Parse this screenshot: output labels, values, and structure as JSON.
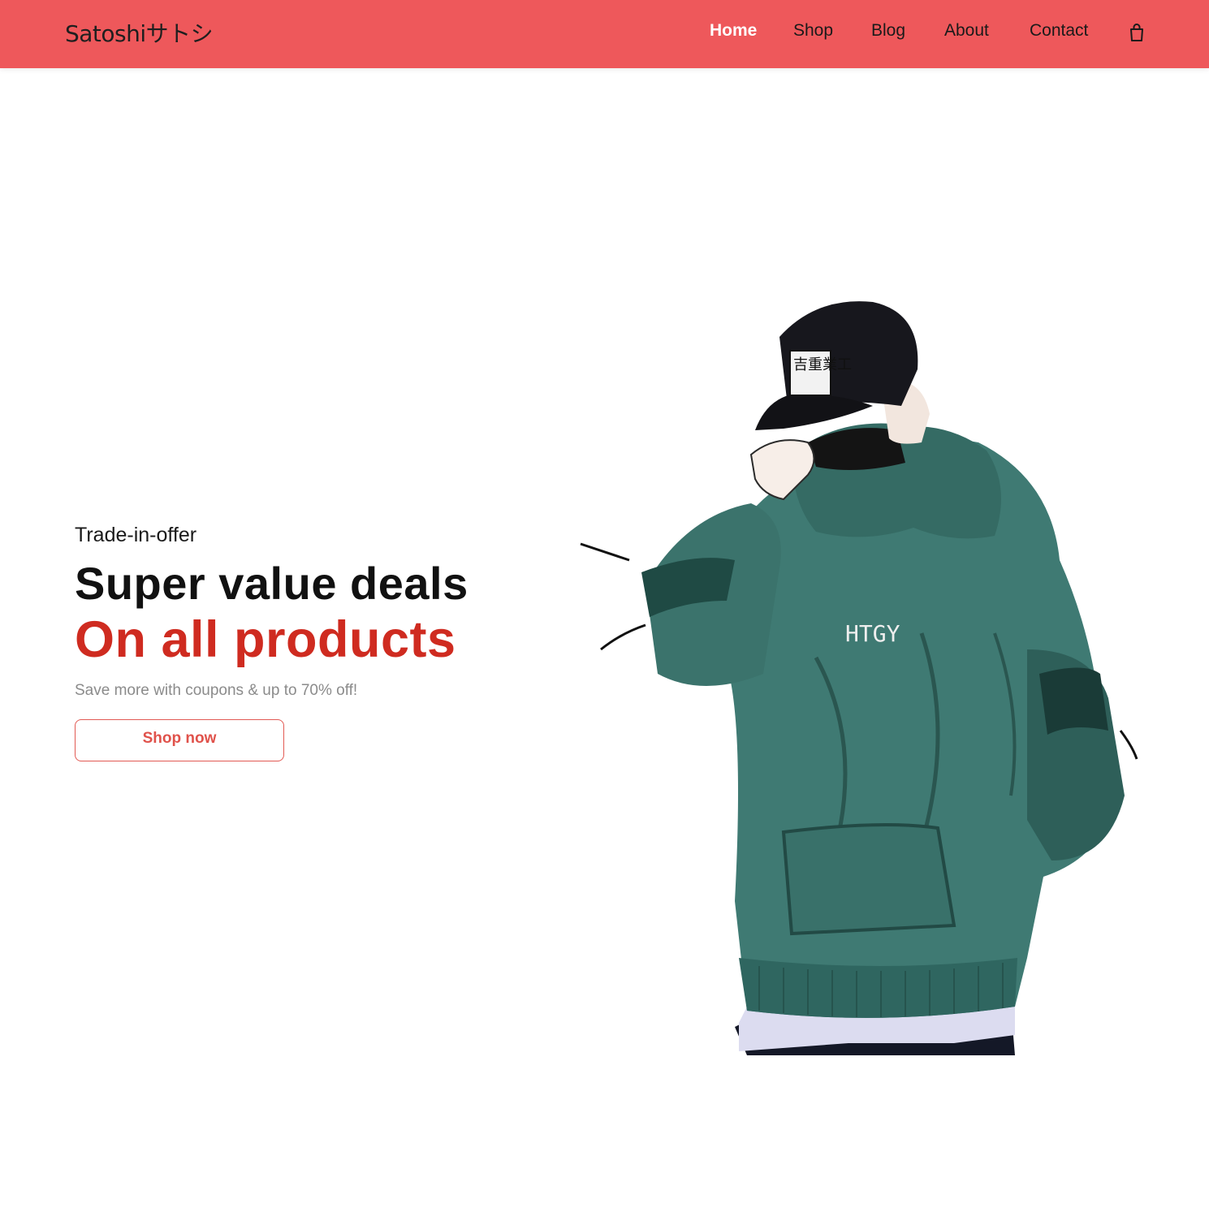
{
  "brand": {
    "logo_text": "Satoshiサトシ"
  },
  "nav": {
    "items": [
      {
        "label": "Home",
        "active": true
      },
      {
        "label": "Shop",
        "active": false
      },
      {
        "label": "Blog",
        "active": false
      },
      {
        "label": "About",
        "active": false
      },
      {
        "label": "Contact",
        "active": false
      }
    ],
    "cart_icon": "shopping-bag-icon"
  },
  "hero": {
    "eyebrow": "Trade-in-offer",
    "headline": "Super value deals",
    "headline_accent": "On all products",
    "subtext": "Save more with coupons & up to 70% off!",
    "cta_label": "Shop now",
    "image_alt": "Illustration of person in green hoodie and black cap",
    "cap_patch_text": "吉重業工",
    "hoodie_print": "HTGY"
  },
  "colors": {
    "nav_background": "#ee585b",
    "accent_red": "#cf2b20",
    "button_border": "#e25a54",
    "hoodie_green": "#3f7a73"
  }
}
